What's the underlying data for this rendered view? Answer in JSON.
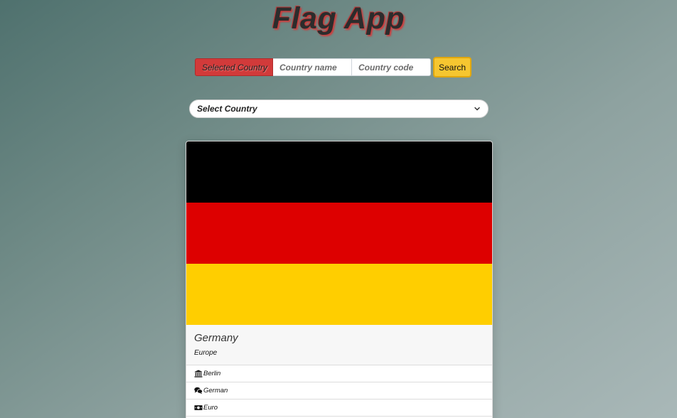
{
  "app": {
    "title": "Flag App"
  },
  "search": {
    "selected_label": "Selected Country",
    "name_placeholder": "Country name",
    "code_placeholder": "Country code",
    "button_label": "Search"
  },
  "dropdown": {
    "selected": "Select Country"
  },
  "country": {
    "name": "Germany",
    "region": "Europe",
    "flag_colors": [
      "#000000",
      "#dd0000",
      "#ffce00"
    ],
    "details": [
      {
        "icon": "landmark-icon",
        "value": "Berlin"
      },
      {
        "icon": "comments-icon",
        "value": "German"
      },
      {
        "icon": "money-bill-icon",
        "value": "Euro"
      }
    ]
  }
}
